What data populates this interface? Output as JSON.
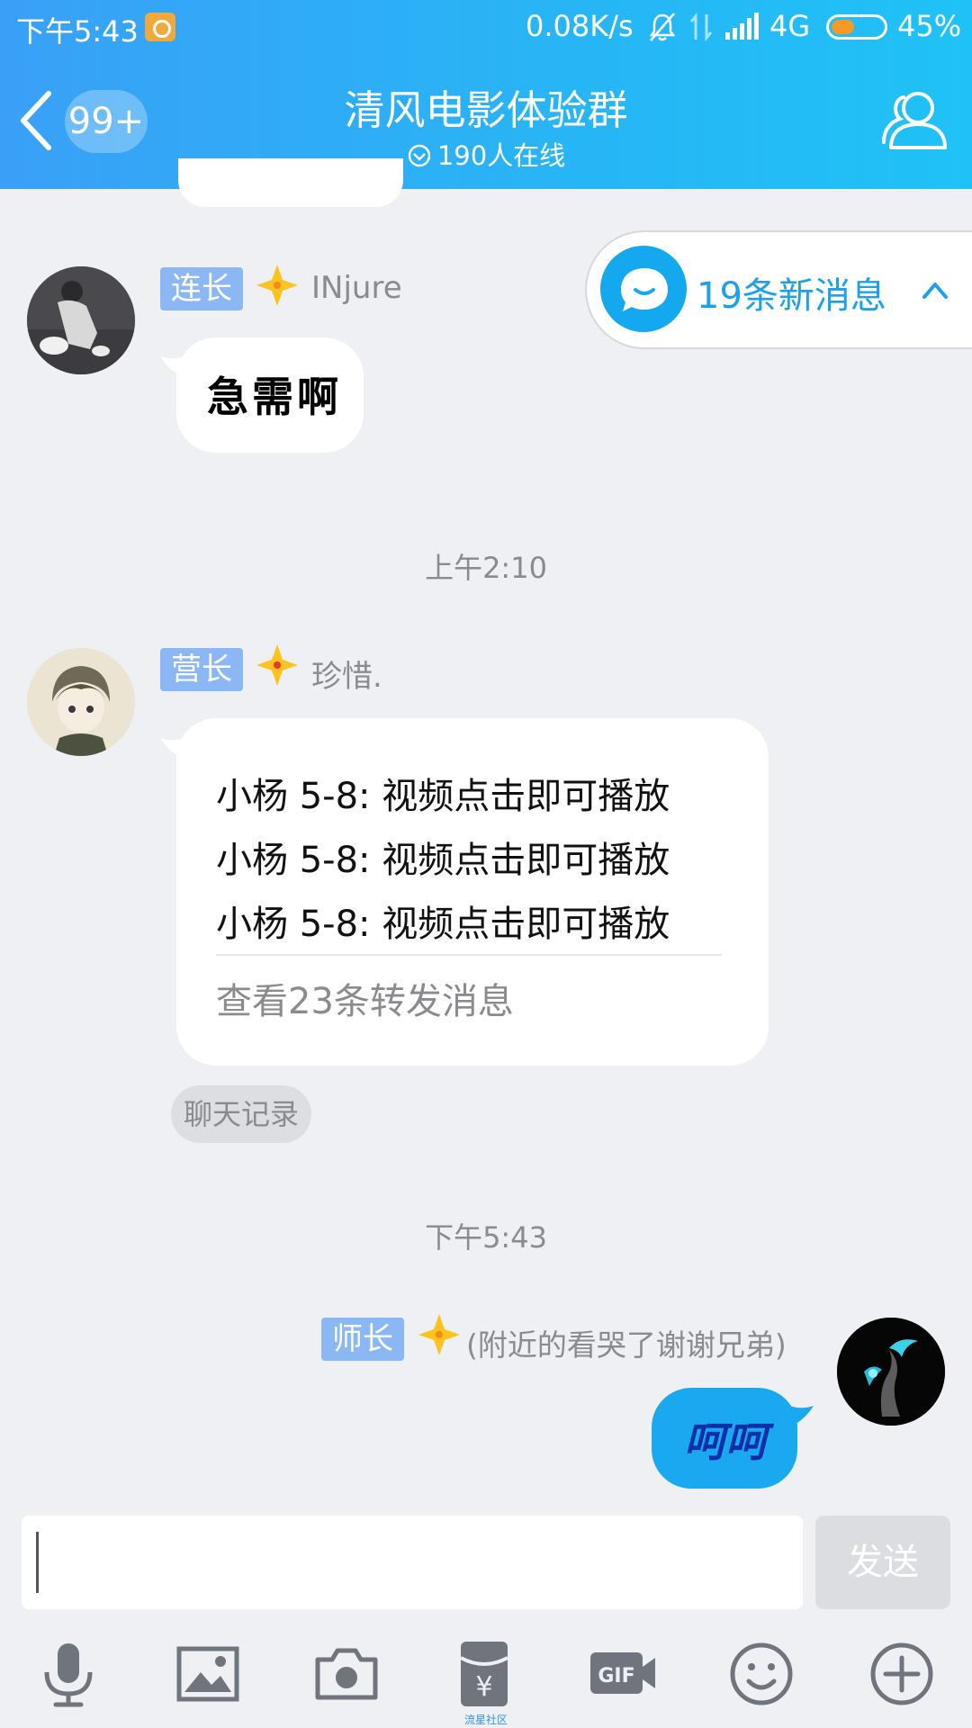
{
  "status_bar": {
    "time": "下午5:43",
    "net_speed": "0.08K/s",
    "network": "4G",
    "battery_percent": "45%",
    "battery_level": 0.45
  },
  "header": {
    "unread_badge": "99+",
    "group_title": "清风电影体验群",
    "online_count": "190人在线"
  },
  "new_message_pill": {
    "label": "19条新消息"
  },
  "messages": [
    {
      "rank": "连长",
      "nickname": "INjure",
      "text": "急需啊"
    },
    {
      "timestamp": "上午2:10"
    },
    {
      "rank": "营长",
      "nickname": "珍惜.",
      "forward_lines": [
        "小杨  5-8:  视频点击即可播放",
        "小杨  5-8:  视频点击即可播放",
        "小杨  5-8:  视频点击即可播放"
      ],
      "forward_more": "查看23条转发消息",
      "forward_tag": "聊天记录"
    },
    {
      "timestamp": "下午5:43"
    },
    {
      "rank": "师长",
      "nickname": "(附近的看哭了谢谢兄弟)",
      "text": "呵呵"
    }
  ],
  "input": {
    "value": "",
    "send_label": "发送"
  },
  "toolbar": {
    "items": [
      "microphone-icon",
      "image-icon",
      "camera-icon",
      "red-packet-icon",
      "gif-icon",
      "emoji-icon",
      "plus-icon"
    ],
    "red_packet_caption": "流星社区"
  },
  "colors": {
    "header_start": "#3aa0f7",
    "header_end": "#1fc2f7",
    "self_bubble": "#1aa8f1",
    "rank_badge": "#8bb8f4",
    "accent_text": "#1aa0ec"
  }
}
